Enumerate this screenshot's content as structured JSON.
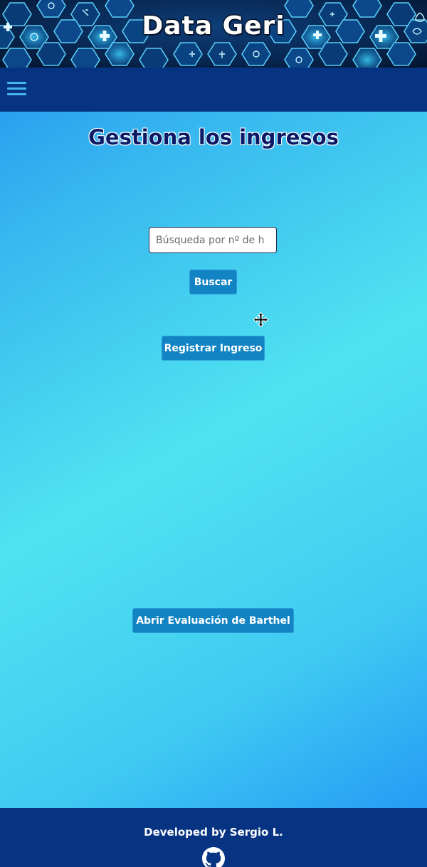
{
  "app": {
    "title": "Data Geri"
  },
  "navbar": {
    "menu_icon": "hamburger-menu-icon"
  },
  "main": {
    "title": "Gestiona los ingresos",
    "search": {
      "placeholder": "Búsqueda por nº de h",
      "value": ""
    },
    "buttons": {
      "search_label": "Buscar",
      "register_label": "Registrar Ingreso",
      "barthel_label": "Abrir Evaluación de Barthel"
    }
  },
  "footer": {
    "credit": "Developed by Sergio L.",
    "icon": "github-icon"
  },
  "colors": {
    "navbar": "#063483",
    "button": "#1284c4",
    "title": "#0b1a66",
    "hamburger": "#46b4ee"
  }
}
